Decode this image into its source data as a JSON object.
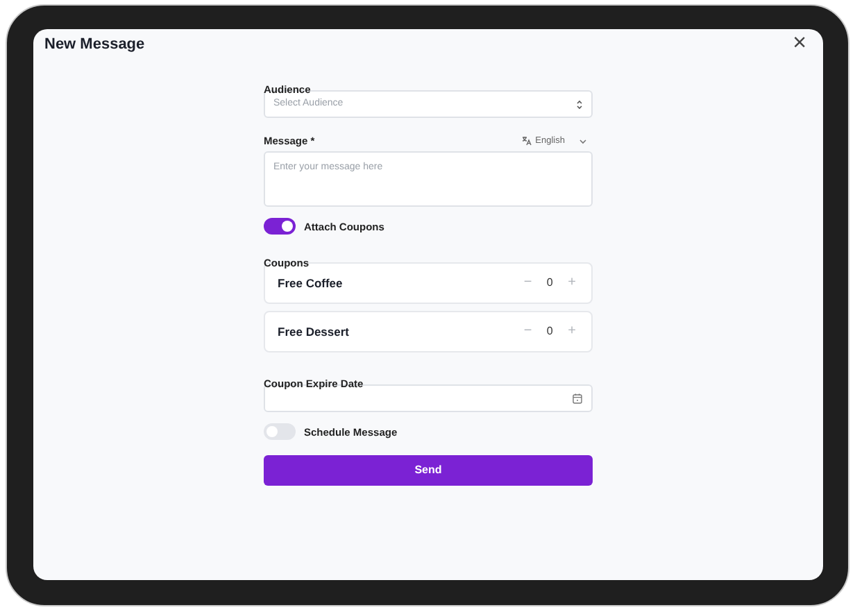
{
  "dialog": {
    "title": "New Message",
    "close": "×"
  },
  "audience": {
    "label": "Audience",
    "placeholder": "Select Audience"
  },
  "message": {
    "label": "Message *",
    "language": "English",
    "placeholder": "Enter your message here"
  },
  "attach_coupons": {
    "label": "Attach Coupons",
    "on": true
  },
  "coupons": {
    "label": "Coupons",
    "items": [
      {
        "name": "Free Coffee",
        "minus": "−",
        "count": "0",
        "plus": "+"
      },
      {
        "name": "Free Dessert",
        "minus": "−",
        "count": "0",
        "plus": "+"
      }
    ]
  },
  "expire_date": {
    "label": "Coupon Expire Date"
  },
  "schedule_message": {
    "label": "Schedule Message",
    "on": false
  },
  "send_button": "Send"
}
